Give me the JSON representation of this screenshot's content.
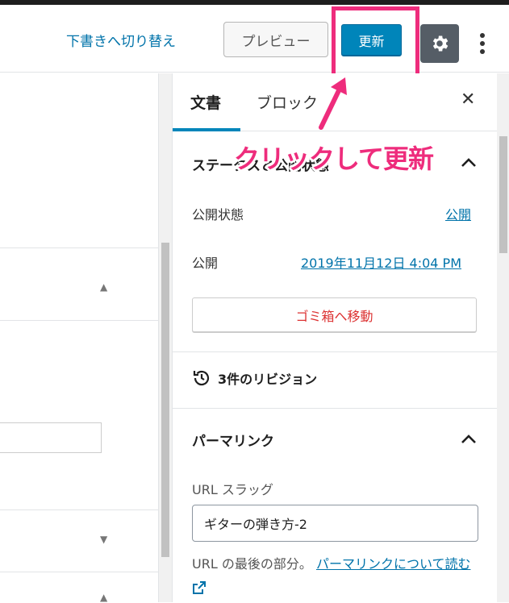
{
  "header": {
    "switch_to_draft": "下書きへ切り替え",
    "preview": "プレビュー",
    "update": "更新"
  },
  "sidebar": {
    "tabs": [
      {
        "label": "文書",
        "active": true
      },
      {
        "label": "ブロック",
        "active": false
      }
    ],
    "status_section": {
      "title": "ステータスと公開状態",
      "visibility_label": "公開状態",
      "visibility_value": "公開",
      "publish_label": "公開",
      "publish_value": "2019年11月12日 4:04 PM",
      "trash_button": "ゴミ箱へ移動"
    },
    "revisions": {
      "label": "3件のリビジョン"
    },
    "permalink": {
      "title": "パーマリンク",
      "slug_label": "URL スラッグ",
      "slug_value": "ギターの弾き方-2",
      "help_text": "URL の最後の部分。",
      "help_link": "パーマリンクについて読む"
    }
  },
  "annotation": {
    "text": "クリックして更新"
  },
  "colors": {
    "accent": "#0085ba",
    "link": "#0073aa",
    "highlight": "#ee2c7c",
    "danger": "#dc3232"
  }
}
